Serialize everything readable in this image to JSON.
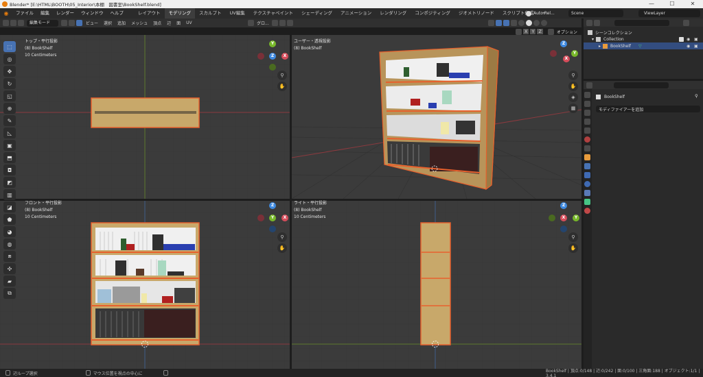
{
  "window": {
    "title": "Blender* [E:\\HTML\\BOOTH\\05_Interior\\本棚　図書室\\BookShelf.blend]",
    "minimize": "—",
    "maximize": "☐",
    "close": "✕"
  },
  "menu": {
    "items": [
      "ファイル",
      "編集",
      "レンダー",
      "ウィンドウ",
      "ヘルプ"
    ],
    "workspaces": [
      "レイアウト",
      "モデリング",
      "スカルプト",
      "UV編集",
      "テクスチャペイント",
      "シェーディング",
      "アニメーション",
      "レンダリング",
      "コンポジティング",
      "ジオメトリノード",
      "スクリプト作成"
    ],
    "add_tab": "+",
    "auto_label": "Auto Rel...",
    "scene": "Scene",
    "view_layer": "ViewLayer"
  },
  "view_header": {
    "mode": "編集モード",
    "items": [
      "ビュー",
      "選択",
      "追加",
      "メッシュ",
      "頂点",
      "辺",
      "面",
      "UV"
    ],
    "orientation": "グロ...",
    "axes": [
      "X",
      "Y",
      "Z"
    ],
    "options": "オプション"
  },
  "viewports": {
    "top": {
      "title": "トップ・平行投影",
      "object": "(8) BookShelf",
      "scale": "10 Centimeters"
    },
    "user": {
      "title": "ユーザー・透視投影",
      "object": "(8) BookShelf",
      "scale": "10 Centimeters"
    },
    "front": {
      "title": "フロント・平行投影",
      "object": "(8) BookShelf",
      "scale": "10 Centimeters"
    },
    "right": {
      "title": "ライト・平行投影",
      "object": "(8) BookShelf",
      "scale": "10 Centimeters"
    }
  },
  "gizmo_labels": {
    "x": "X",
    "y": "Y",
    "z": "Z"
  },
  "outliner": {
    "root": "シーンコレクション",
    "collection": "Collection",
    "object": "BookShelf"
  },
  "properties": {
    "object_name": "BookShelf",
    "add_modifier": "モディファイアーを追加"
  },
  "status": {
    "left": "辺ループ選択",
    "middle": "マウス位置を視点の中心に",
    "right": "BookShelf | 頂点:0/148 | 辺:0/242 | 面:0/100 | 三角面:188 | オブジェクト:1/1 | 3.4.1"
  },
  "colors": {
    "viewport_bg": "#3b3b3b",
    "accent": "#4772b3",
    "wood": "#c8a86a",
    "edge": "#e8602c",
    "x_axis": "#d64d5b",
    "y_axis": "#78b82a",
    "z_axis": "#3f8ae0"
  }
}
